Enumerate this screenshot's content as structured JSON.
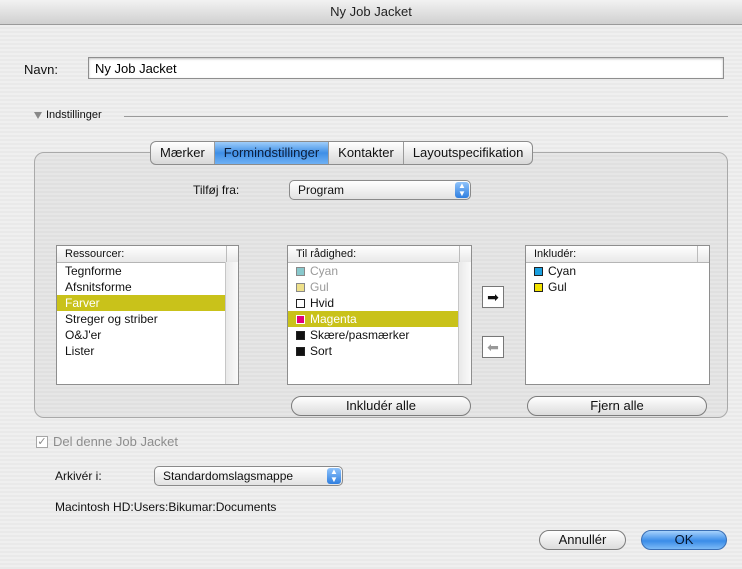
{
  "window": {
    "title": "Ny Job Jacket"
  },
  "name_field": {
    "label": "Navn:",
    "value": "Ny Job Jacket"
  },
  "settings": {
    "label": "Indstillinger"
  },
  "tabs": [
    {
      "label": "Mærker",
      "active": false
    },
    {
      "label": "Formindstillinger",
      "active": true
    },
    {
      "label": "Kontakter",
      "active": false
    },
    {
      "label": "Layoutspecifikation",
      "active": false
    }
  ],
  "add_from": {
    "label": "Tilføj fra:",
    "value": "Program"
  },
  "resources": {
    "header": "Ressourcer:",
    "items": [
      "Tegnforme",
      "Afsnitsforme",
      "Farver",
      "Streger og striber",
      "O&J'er",
      "Lister"
    ],
    "selected_index": 2
  },
  "available": {
    "header": "Til rådighed:",
    "items": [
      {
        "label": "Cyan",
        "color": "#88c8cc",
        "dim": true
      },
      {
        "label": "Gul",
        "color": "#eee08a",
        "dim": true
      },
      {
        "label": "Hvid",
        "color": "#ffffff",
        "dim": false
      },
      {
        "label": "Magenta",
        "color": "#e0007a",
        "dim": false,
        "selected": true
      },
      {
        "label": "Skære/pasmærker",
        "color": "#111111",
        "dim": false
      },
      {
        "label": "Sort",
        "color": "#111111",
        "dim": false
      }
    ]
  },
  "included": {
    "header": "Inkludér:",
    "items": [
      {
        "label": "Cyan",
        "color": "#1aa0e0"
      },
      {
        "label": "Gul",
        "color": "#f2e200"
      }
    ]
  },
  "buttons": {
    "include_all": "Inkludér alle",
    "remove_all": "Fjern alle",
    "cancel": "Annullér",
    "ok": "OK",
    "move_right": "right-arrow",
    "move_left": "left-arrow"
  },
  "share": {
    "label": "Del denne Job Jacket",
    "checked": true
  },
  "archive": {
    "label": "Arkivér i:",
    "value": "Standardomslagsmappe"
  },
  "path": "Macintosh HD:Users:Bikumar:Documents",
  "colors": {
    "selection": "#c9c21a",
    "accent": "#3a8ce8"
  }
}
